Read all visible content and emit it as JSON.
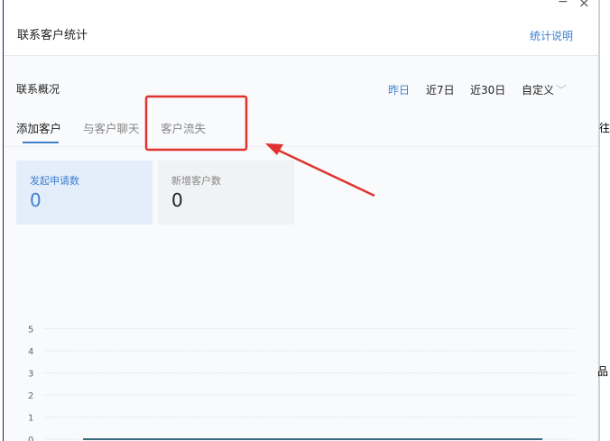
{
  "window": {
    "minimize": "−",
    "close": "×",
    "title": "联系客户统计",
    "help_link": "统计说明"
  },
  "section": {
    "title": "联系概况",
    "ranges": [
      "昨日",
      "近7日",
      "近30日",
      "自定义"
    ],
    "active_range": "昨日"
  },
  "tabs": [
    "添加客户",
    "与客户聊天",
    "客户流失"
  ],
  "cards": [
    {
      "label": "发起申请数",
      "value": "0"
    },
    {
      "label": "新增客户数",
      "value": "0"
    }
  ],
  "background": {
    "text1": "往",
    "text2": "品"
  },
  "colors": {
    "accent": "#3f7fd0",
    "annotation": "#e0332f"
  },
  "chart_data": {
    "type": "line",
    "yticks": [
      "0",
      "1",
      "2",
      "3",
      "4",
      "5"
    ],
    "ylim": [
      0,
      5
    ],
    "series": [
      {
        "name": "发起申请数",
        "values": [
          0,
          0
        ]
      }
    ],
    "grid": true
  }
}
